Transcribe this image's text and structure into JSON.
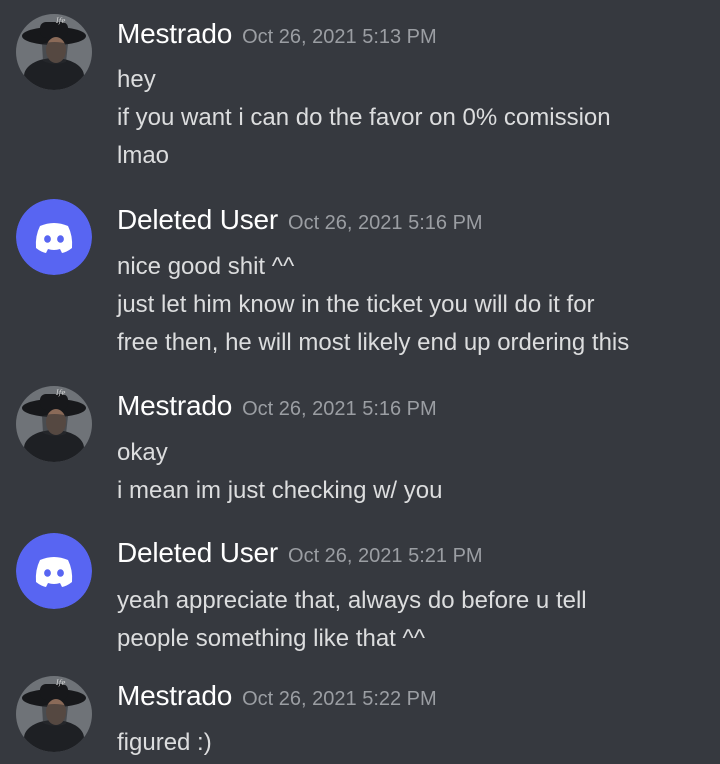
{
  "messages": [
    {
      "author": "Mestrado",
      "avatar_icon": "user-photo-avatar",
      "timestamp": "Oct 26, 2021 5:13 PM",
      "lines": [
        "hey",
        "if you want i can do the favor on 0% comission",
        "lmao"
      ]
    },
    {
      "author": "Deleted User",
      "avatar_icon": "discord-logo-icon",
      "timestamp": "Oct 26, 2021 5:16 PM",
      "lines": [
        "nice good shit ^^",
        "just let him know in the ticket you will do it for",
        "free then, he will most likely end up ordering this"
      ]
    },
    {
      "author": "Mestrado",
      "avatar_icon": "user-photo-avatar",
      "timestamp": "Oct 26, 2021 5:16 PM",
      "lines": [
        "okay",
        "i mean im just checking w/ you"
      ]
    },
    {
      "author": "Deleted User",
      "avatar_icon": "discord-logo-icon",
      "timestamp": "Oct 26, 2021 5:21 PM",
      "lines": [
        "yeah appreciate that, always do before u tell",
        "people something like that ^^"
      ]
    },
    {
      "author": "Mestrado",
      "avatar_icon": "user-photo-avatar",
      "timestamp": "Oct 26, 2021 5:22 PM",
      "lines": [
        "figured :)"
      ]
    }
  ],
  "colors": {
    "background": "#36393f",
    "discord_blurple": "#5865f2",
    "username": "#ffffff",
    "timestamp": "#9b9ea3",
    "message_text": "#dcddde"
  }
}
